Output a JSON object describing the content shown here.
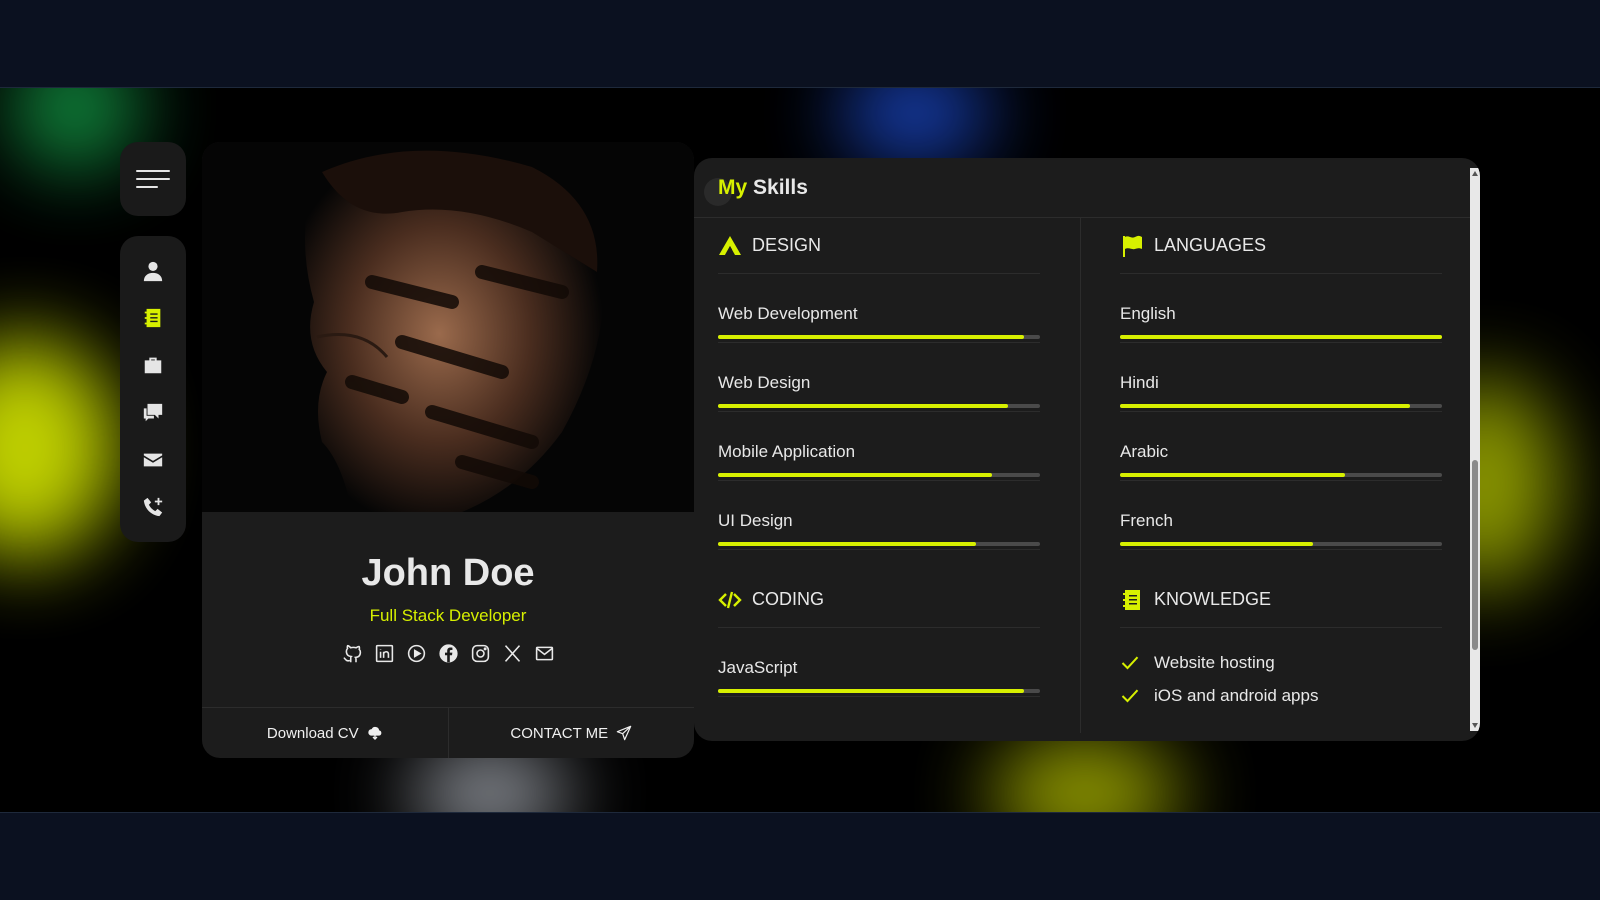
{
  "colors": {
    "accent": "#d7f000",
    "card": "#1c1c1c",
    "page_bg": "#0b1120"
  },
  "nav": {
    "menu_icon": "hamburger-menu-icon",
    "items": [
      {
        "icon": "user-icon",
        "active": false
      },
      {
        "icon": "notebook-icon",
        "active": true
      },
      {
        "icon": "briefcase-icon",
        "active": false
      },
      {
        "icon": "chat-icon",
        "active": false
      },
      {
        "icon": "envelope-icon",
        "active": false
      },
      {
        "icon": "phone-icon",
        "active": false
      }
    ]
  },
  "profile": {
    "name": "John Doe",
    "role": "Full Stack Developer",
    "socials": [
      "github-icon",
      "linkedin-icon",
      "youtube-icon",
      "facebook-icon",
      "instagram-icon",
      "x-icon",
      "mail-icon"
    ],
    "download_label": "Download CV",
    "contact_label": "CONTACT ME"
  },
  "skills": {
    "title_highlight": "My",
    "title_rest": "Skills",
    "design": {
      "title": "DESIGN",
      "items": [
        {
          "label": "Web Development",
          "percent": 95
        },
        {
          "label": "Web Design",
          "percent": 90
        },
        {
          "label": "Mobile Application",
          "percent": 85
        },
        {
          "label": "UI Design",
          "percent": 80
        }
      ]
    },
    "coding": {
      "title": "CODING",
      "items": [
        {
          "label": "JavaScript",
          "percent": 95
        }
      ]
    },
    "languages": {
      "title": "LANGUAGES",
      "items": [
        {
          "label": "English",
          "percent": 100
        },
        {
          "label": "Hindi",
          "percent": 90
        },
        {
          "label": "Arabic",
          "percent": 70
        },
        {
          "label": "French",
          "percent": 60
        }
      ]
    },
    "knowledge": {
      "title": "KNOWLEDGE",
      "items": [
        "Website hosting",
        "iOS and android apps"
      ]
    }
  }
}
